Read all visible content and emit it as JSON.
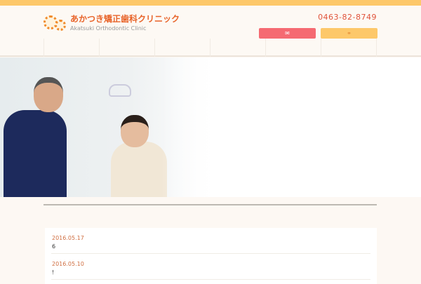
{
  "header": {
    "logo_jp": "あかつき矯正歯科クリニック",
    "logo_en": "Akatsuki Orthodontic Clinic",
    "phone": "0463-82-8749",
    "mail_icon": "✉",
    "access_icon": "⚭"
  },
  "colors": {
    "accent": "#fdc86a",
    "mail": "#f56a72",
    "date": "#d06f42"
  },
  "news": [
    {
      "date": "2016.05.17",
      "title": "6"
    },
    {
      "date": "2016.05.10",
      "title": "!"
    }
  ]
}
